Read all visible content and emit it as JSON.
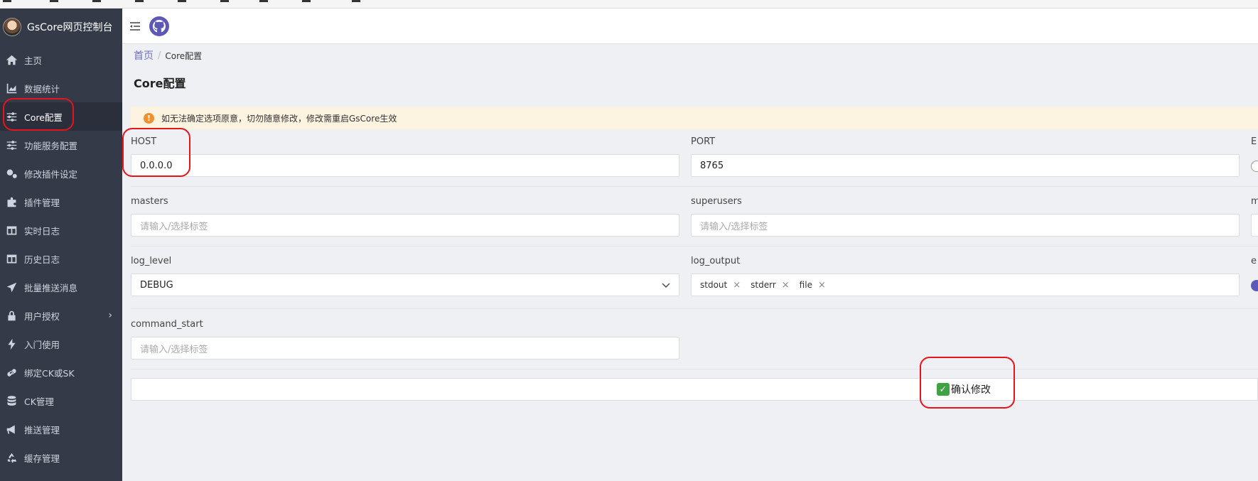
{
  "app": {
    "title": "GsCore网页控制台"
  },
  "sidebar": {
    "items": [
      {
        "label": "主页",
        "icon": "home-icon"
      },
      {
        "label": "数据统计",
        "icon": "chart-icon"
      },
      {
        "label": "Core配置",
        "icon": "sliders-icon"
      },
      {
        "label": "功能服务配置",
        "icon": "sliders-icon"
      },
      {
        "label": "修改插件设定",
        "icon": "gears-icon"
      },
      {
        "label": "插件管理",
        "icon": "puzzle-icon"
      },
      {
        "label": "实时日志",
        "icon": "table-icon"
      },
      {
        "label": "历史日志",
        "icon": "table-icon"
      },
      {
        "label": "批量推送消息",
        "icon": "paper-plane-icon"
      },
      {
        "label": "用户授权",
        "icon": "lock-icon"
      },
      {
        "label": "入门使用",
        "icon": "bolt-icon"
      },
      {
        "label": "绑定CK或SK",
        "icon": "link-icon"
      },
      {
        "label": "CK管理",
        "icon": "database-icon"
      },
      {
        "label": "推送管理",
        "icon": "megaphone-icon"
      },
      {
        "label": "缓存管理",
        "icon": "recycle-icon"
      }
    ]
  },
  "breadcrumb": {
    "home": "首页",
    "sep": "/",
    "current": "Core配置"
  },
  "page": {
    "title": "Core配置"
  },
  "alert": {
    "text": "如无法确定选项原意，切勿随意修改，修改需重启GsCore生效",
    "icon": "!"
  },
  "form": {
    "host": {
      "label": "HOST",
      "value": "0.0.0.0"
    },
    "port": {
      "label": "PORT",
      "value": "8765"
    },
    "col3_row1_label": "E",
    "masters": {
      "label": "masters",
      "placeholder": "请输入/选择标签"
    },
    "superusers": {
      "label": "superusers",
      "placeholder": "请输入/选择标签"
    },
    "col3_row2_label": "m",
    "log_level": {
      "label": "log_level",
      "value": "DEBUG"
    },
    "log_output": {
      "label": "log_output",
      "tags": [
        "stdout",
        "stderr",
        "file"
      ],
      "remove": "×"
    },
    "col3_row3_label": "e",
    "command_start": {
      "label": "command_start",
      "placeholder": "请输入/选择标签"
    }
  },
  "submit": {
    "check": "✓",
    "label": "确认修改"
  },
  "colors": {
    "sidebar_bg": "#343a48",
    "accent": "#5c58b8",
    "alert_bg": "#fdf3e1",
    "annotation": "#e8141b"
  }
}
